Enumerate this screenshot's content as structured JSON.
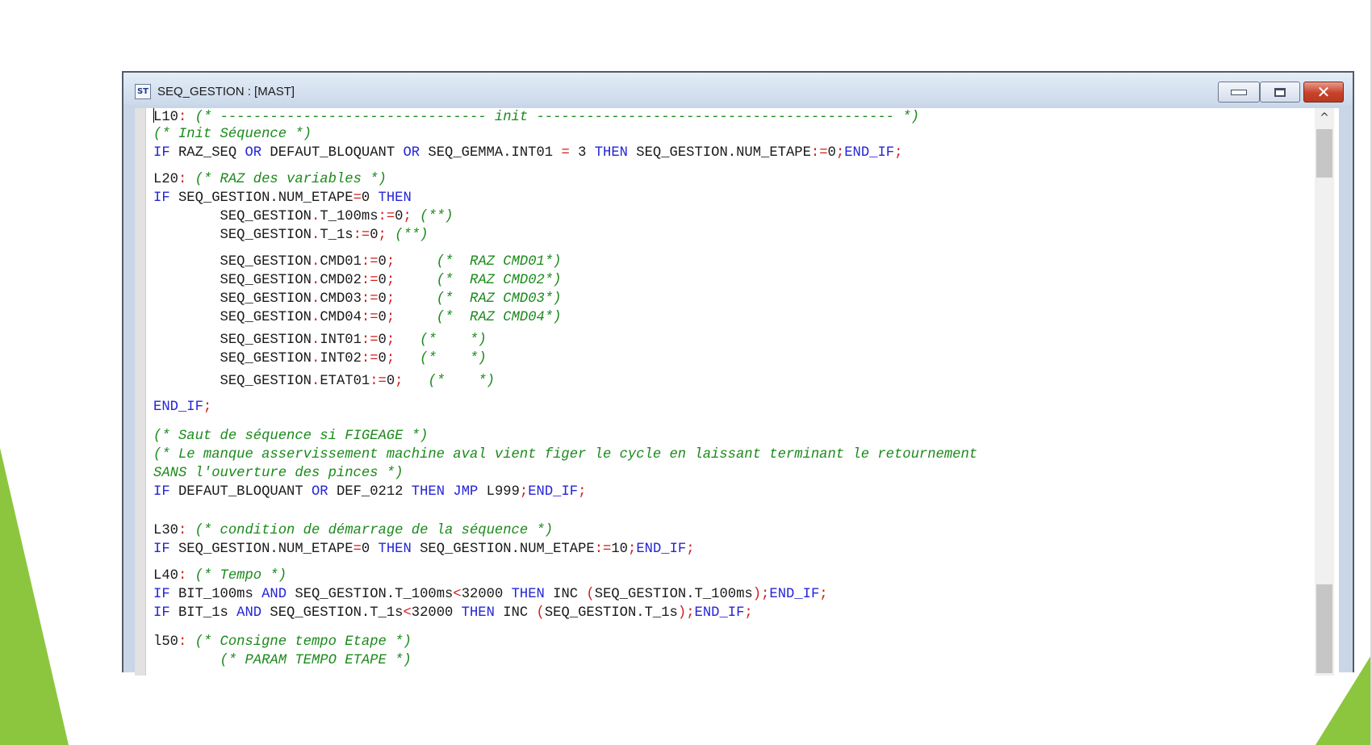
{
  "window": {
    "icon_label": "ST",
    "title": "SEQ_GESTION : [MAST]",
    "controls": {
      "minimize": "minimize",
      "maximize": "maximize",
      "close": "close"
    }
  },
  "scrollbar": {
    "up_arrow": "^"
  },
  "theme": {
    "comment_color": "#1b8a1b",
    "keyword_color": "#2525d8",
    "operator_color": "#d11c1c",
    "deco_green": "#8cc63f"
  },
  "code_lines": [
    [
      [
        "t",
        "L10"
      ],
      [
        "o",
        ":"
      ],
      [
        "c",
        " (* -------------------------------- init ------------------------------------------- *)"
      ]
    ],
    [
      [
        "c",
        "(* Init Séquence *)"
      ]
    ],
    [
      [
        "k",
        "IF"
      ],
      [
        "t",
        " RAZ_SEQ "
      ],
      [
        "k",
        "OR"
      ],
      [
        "t",
        " DEFAUT_BLOQUANT "
      ],
      [
        "k",
        "OR"
      ],
      [
        "t",
        " SEQ_GEMMA.INT01 "
      ],
      [
        "o",
        "="
      ],
      [
        "t",
        " 3 "
      ],
      [
        "k",
        "THEN"
      ],
      [
        "t",
        " SEQ_GESTION.NUM_ETAPE"
      ],
      [
        "o",
        ":="
      ],
      [
        "t",
        "0"
      ],
      [
        "o",
        ";"
      ],
      [
        "k",
        "END_IF"
      ],
      [
        "o",
        ";"
      ]
    ],
    [
      [
        "t",
        "L20"
      ],
      [
        "o",
        ":"
      ],
      [
        "c",
        " (* RAZ des variables *)"
      ]
    ],
    [
      [
        "k",
        "IF"
      ],
      [
        "t",
        " SEQ_GESTION.NUM_ETAPE"
      ],
      [
        "o",
        "="
      ],
      [
        "t",
        "0 "
      ],
      [
        "k",
        "THEN"
      ]
    ],
    [
      [
        "t",
        "        SEQ_GESTION"
      ],
      [
        "o",
        "."
      ],
      [
        "t",
        "T_100ms"
      ],
      [
        "o",
        ":="
      ],
      [
        "t",
        "0"
      ],
      [
        "o",
        ";"
      ],
      [
        "c",
        " (**)"
      ]
    ],
    [
      [
        "t",
        "        SEQ_GESTION"
      ],
      [
        "o",
        "."
      ],
      [
        "t",
        "T_1s"
      ],
      [
        "o",
        ":="
      ],
      [
        "t",
        "0"
      ],
      [
        "o",
        ";"
      ],
      [
        "c",
        " (**)"
      ]
    ],
    [
      [
        "t",
        "        SEQ_GESTION"
      ],
      [
        "o",
        "."
      ],
      [
        "t",
        "CMD01"
      ],
      [
        "o",
        ":="
      ],
      [
        "t",
        "0"
      ],
      [
        "o",
        ";"
      ],
      [
        "c",
        "     (*  RAZ CMD01*)"
      ]
    ],
    [
      [
        "t",
        "        SEQ_GESTION"
      ],
      [
        "o",
        "."
      ],
      [
        "t",
        "CMD02"
      ],
      [
        "o",
        ":="
      ],
      [
        "t",
        "0"
      ],
      [
        "o",
        ";"
      ],
      [
        "c",
        "     (*  RAZ CMD02*)"
      ]
    ],
    [
      [
        "t",
        "        SEQ_GESTION"
      ],
      [
        "o",
        "."
      ],
      [
        "t",
        "CMD03"
      ],
      [
        "o",
        ":="
      ],
      [
        "t",
        "0"
      ],
      [
        "o",
        ";"
      ],
      [
        "c",
        "     (*  RAZ CMD03*)"
      ]
    ],
    [
      [
        "t",
        "        SEQ_GESTION"
      ],
      [
        "o",
        "."
      ],
      [
        "t",
        "CMD04"
      ],
      [
        "o",
        ":="
      ],
      [
        "t",
        "0"
      ],
      [
        "o",
        ";"
      ],
      [
        "c",
        "     (*  RAZ CMD04*)"
      ]
    ],
    [
      [
        "t",
        "        SEQ_GESTION"
      ],
      [
        "o",
        "."
      ],
      [
        "t",
        "INT01"
      ],
      [
        "o",
        ":="
      ],
      [
        "t",
        "0"
      ],
      [
        "o",
        ";"
      ],
      [
        "c",
        "   (*    *)"
      ]
    ],
    [
      [
        "t",
        "        SEQ_GESTION"
      ],
      [
        "o",
        "."
      ],
      [
        "t",
        "INT02"
      ],
      [
        "o",
        ":="
      ],
      [
        "t",
        "0"
      ],
      [
        "o",
        ";"
      ],
      [
        "c",
        "   (*    *)"
      ]
    ],
    [
      [
        "t",
        "        SEQ_GESTION"
      ],
      [
        "o",
        "."
      ],
      [
        "t",
        "ETAT01"
      ],
      [
        "o",
        ":="
      ],
      [
        "t",
        "0"
      ],
      [
        "o",
        ";"
      ],
      [
        "c",
        "   (*    *)"
      ]
    ],
    [
      [
        "k",
        "END_IF"
      ],
      [
        "o",
        ";"
      ]
    ],
    [
      [
        "c",
        "(* Saut de séquence si FIGEAGE *)"
      ]
    ],
    [
      [
        "c",
        "(* Le manque asservissement machine aval vient figer le cycle en laissant terminant le retournement"
      ]
    ],
    [
      [
        "c",
        "SANS l'ouverture des pinces *)"
      ]
    ],
    [
      [
        "k",
        "IF"
      ],
      [
        "t",
        " DEFAUT_BLOQUANT "
      ],
      [
        "k",
        "OR"
      ],
      [
        "t",
        " DEF_0212 "
      ],
      [
        "k",
        "THEN"
      ],
      [
        "t",
        " "
      ],
      [
        "k",
        "JMP"
      ],
      [
        "t",
        " L999"
      ],
      [
        "o",
        ";"
      ],
      [
        "k",
        "END_IF"
      ],
      [
        "o",
        ";"
      ]
    ],
    [
      [
        "t",
        "L30"
      ],
      [
        "o",
        ":"
      ],
      [
        "c",
        " (* condition de démarrage de la séquence *)"
      ]
    ],
    [
      [
        "k",
        "IF"
      ],
      [
        "t",
        " SEQ_GESTION.NUM_ETAPE"
      ],
      [
        "o",
        "="
      ],
      [
        "t",
        "0 "
      ],
      [
        "k",
        "THEN"
      ],
      [
        "t",
        " SEQ_GESTION.NUM_ETAPE"
      ],
      [
        "o",
        ":="
      ],
      [
        "t",
        "10"
      ],
      [
        "o",
        ";"
      ],
      [
        "k",
        "END_IF"
      ],
      [
        "o",
        ";"
      ]
    ],
    [
      [
        "t",
        "L40"
      ],
      [
        "o",
        ":"
      ],
      [
        "c",
        " (* Tempo *)"
      ]
    ],
    [
      [
        "k",
        "IF"
      ],
      [
        "t",
        " BIT_100ms "
      ],
      [
        "k",
        "AND"
      ],
      [
        "t",
        " SEQ_GESTION.T_100ms"
      ],
      [
        "o",
        "<"
      ],
      [
        "t",
        "32000 "
      ],
      [
        "k",
        "THEN"
      ],
      [
        "t",
        " INC "
      ],
      [
        "o",
        "("
      ],
      [
        "t",
        "SEQ_GESTION.T_100ms"
      ],
      [
        "o",
        ");"
      ],
      [
        "k",
        "END_IF"
      ],
      [
        "o",
        ";"
      ]
    ],
    [
      [
        "k",
        "IF"
      ],
      [
        "t",
        " BIT_1s "
      ],
      [
        "k",
        "AND"
      ],
      [
        "t",
        " SEQ_GESTION.T_1s"
      ],
      [
        "o",
        "<"
      ],
      [
        "t",
        "32000 "
      ],
      [
        "k",
        "THEN"
      ],
      [
        "t",
        " INC "
      ],
      [
        "o",
        "("
      ],
      [
        "t",
        "SEQ_GESTION.T_1s"
      ],
      [
        "o",
        ");"
      ],
      [
        "k",
        "END_IF"
      ],
      [
        "o",
        ";"
      ]
    ],
    [
      [
        "t",
        "l50"
      ],
      [
        "o",
        ":"
      ],
      [
        "c",
        " (* Consigne tempo Etape *)"
      ]
    ],
    [
      [
        "c",
        "        (* PARAM TEMPO ETAPE *)"
      ]
    ]
  ]
}
